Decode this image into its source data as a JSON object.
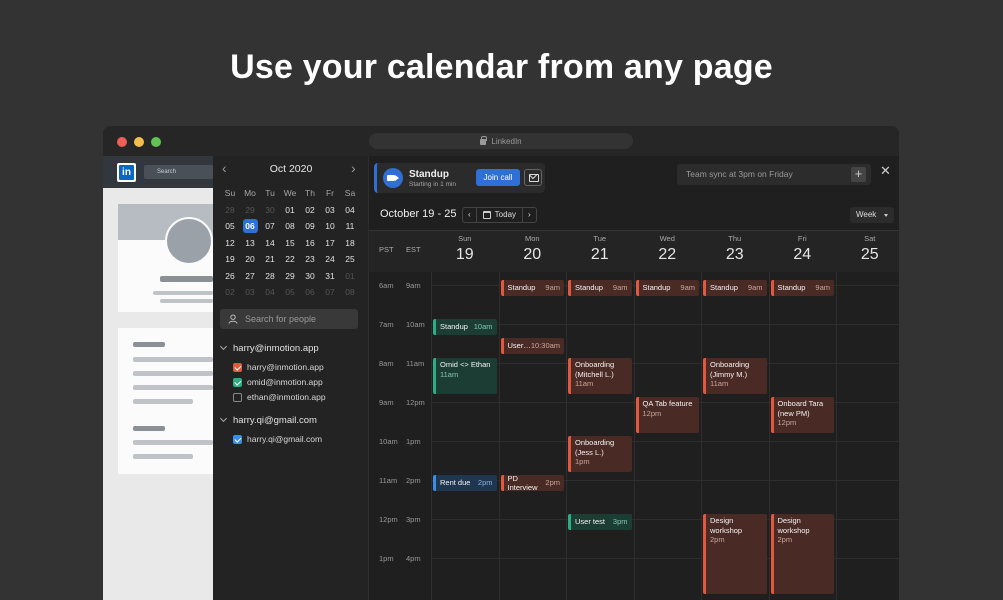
{
  "headline": "Use your calendar from any page",
  "browser": {
    "url": "LinkedIn"
  },
  "linkedin": {
    "logo": "in",
    "search_placeholder": "Search"
  },
  "mini_calendar": {
    "month": "Oct 2020",
    "prev": "‹",
    "next": "›",
    "weekdays": [
      "Su",
      "Mo",
      "Tu",
      "We",
      "Th",
      "Fr",
      "Sa"
    ],
    "days": [
      [
        "28",
        "29",
        "30",
        "01",
        "02",
        "03",
        "04"
      ],
      [
        "05",
        "06",
        "07",
        "08",
        "09",
        "10",
        "11"
      ],
      [
        "12",
        "13",
        "14",
        "15",
        "16",
        "17",
        "18"
      ],
      [
        "19",
        "20",
        "21",
        "22",
        "23",
        "24",
        "25"
      ],
      [
        "26",
        "27",
        "28",
        "29",
        "30",
        "31",
        "01"
      ],
      [
        "02",
        "03",
        "04",
        "05",
        "06",
        "07",
        "08"
      ]
    ],
    "today": "06"
  },
  "people_search": {
    "placeholder": "Search for people"
  },
  "accounts": [
    {
      "name": "harry@inmotion.app",
      "calendars": [
        {
          "name": "harry@inmotion.app",
          "checked": true,
          "color": "#e2583e"
        },
        {
          "name": "omid@inmotion.app",
          "checked": true,
          "color": "#2bae84"
        },
        {
          "name": "ethan@inmotion.app",
          "checked": false,
          "color": ""
        }
      ]
    },
    {
      "name": "harry.qi@gmail.com",
      "calendars": [
        {
          "name": "harry.qi@gmail.com",
          "checked": true,
          "color": "#3a8ee6"
        }
      ]
    }
  ],
  "meeting": {
    "title": "Standup",
    "subtitle": "Starting in 1 min",
    "join_label": "Join call",
    "icon": "video-icon"
  },
  "quick_add": {
    "placeholder": "Team sync at 3pm on Friday",
    "plus": "+"
  },
  "close": "✕",
  "toolbar": {
    "range": "October 19 - 25",
    "prev": "‹",
    "today": "Today",
    "next": "›",
    "view": "Week"
  },
  "timezones": [
    "PST",
    "EST"
  ],
  "days": [
    {
      "dow": "Sun",
      "num": "19"
    },
    {
      "dow": "Mon",
      "num": "20"
    },
    {
      "dow": "Tue",
      "num": "21"
    },
    {
      "dow": "Wed",
      "num": "22"
    },
    {
      "dow": "Thu",
      "num": "23"
    },
    {
      "dow": "Fri",
      "num": "24"
    },
    {
      "dow": "Sat",
      "num": "25"
    }
  ],
  "time_labels": [
    {
      "pst": "6am",
      "est": "9am"
    },
    {
      "pst": "7am",
      "est": "10am"
    },
    {
      "pst": "8am",
      "est": "11am"
    },
    {
      "pst": "9am",
      "est": "12pm"
    },
    {
      "pst": "10am",
      "est": "1pm"
    },
    {
      "pst": "11am",
      "est": "2pm"
    },
    {
      "pst": "12pm",
      "est": "3pm"
    },
    {
      "pst": "1pm",
      "est": "4pm"
    }
  ],
  "events": [
    {
      "title": "Standup",
      "time": "9am",
      "day": 1,
      "color": "red"
    },
    {
      "title": "Standup",
      "time": "9am",
      "day": 2,
      "color": "red"
    },
    {
      "title": "Standup",
      "time": "9am",
      "day": 3,
      "color": "red"
    },
    {
      "title": "Standup",
      "time": "9am",
      "day": 4,
      "color": "red"
    },
    {
      "title": "Standup",
      "time": "9am",
      "day": 5,
      "color": "red"
    },
    {
      "title": "Standup",
      "time": "10am",
      "day": 0,
      "color": "green"
    },
    {
      "title": "User…",
      "time": "10:30am",
      "day": 1,
      "color": "red"
    },
    {
      "title": "Omid <> Ethan",
      "time": "11am",
      "day": 0,
      "color": "green"
    },
    {
      "title": "Onboarding (Mitchell L.)",
      "time": "11am",
      "day": 2,
      "color": "red"
    },
    {
      "title": "Onboarding (Jimmy M.)",
      "time": "11am",
      "day": 4,
      "color": "red"
    },
    {
      "title": "QA Tab feature",
      "time": "12pm",
      "day": 3,
      "color": "red"
    },
    {
      "title": "Onboard Tara (new PM)",
      "time": "12pm",
      "day": 5,
      "color": "red"
    },
    {
      "title": "Onboarding (Jess L.)",
      "time": "1pm",
      "day": 2,
      "color": "red"
    },
    {
      "title": "Rent due",
      "time": "2pm",
      "day": 0,
      "color": "blue"
    },
    {
      "title": "PD Interview",
      "time": "2pm",
      "day": 1,
      "color": "red"
    },
    {
      "title": "User test",
      "time": "3pm",
      "day": 2,
      "color": "green"
    },
    {
      "title": "Design workshop",
      "time": "2pm",
      "day": 4,
      "color": "red"
    },
    {
      "title": "Design workshop",
      "time": "2pm",
      "day": 5,
      "color": "red"
    }
  ]
}
